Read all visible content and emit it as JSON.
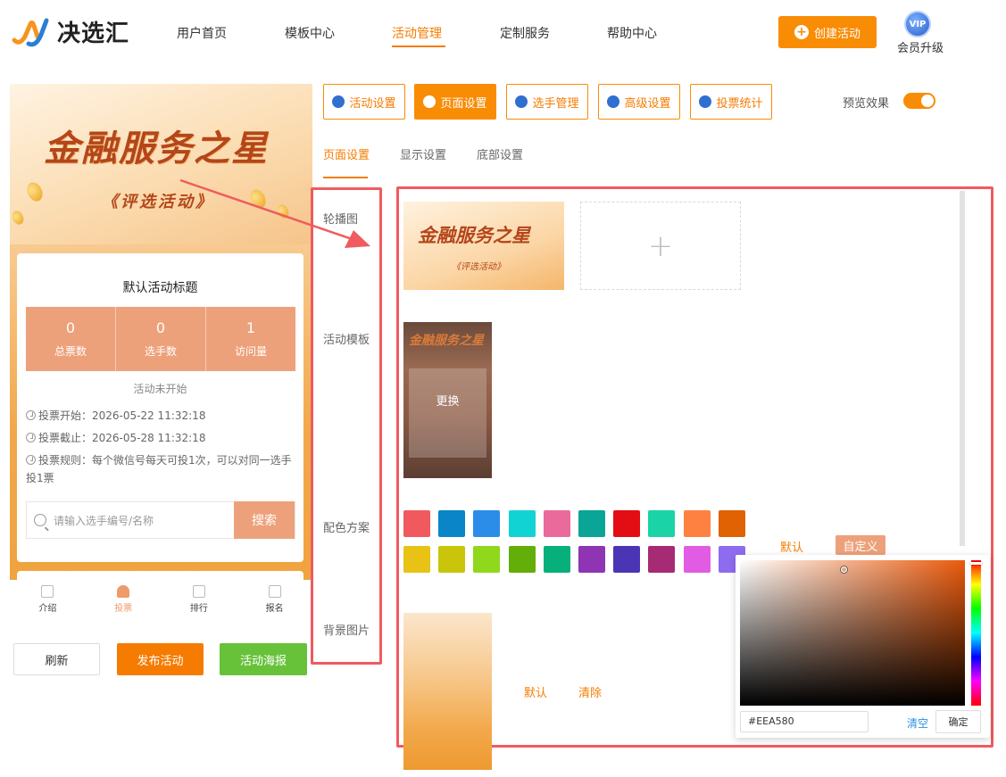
{
  "header": {
    "logo_text": "决选汇",
    "nav": [
      "用户首页",
      "模板中心",
      "活动管理",
      "定制服务",
      "帮助中心"
    ],
    "create_label": "创建活动",
    "vip_badge": "VIP",
    "vip_label": "会员升级"
  },
  "preview": {
    "banner_title": "金融服务之星",
    "banner_sub": "《评选活动》",
    "activity_title": "默认活动标题",
    "stats": [
      {
        "value": "0",
        "label": "总票数"
      },
      {
        "value": "0",
        "label": "选手数"
      },
      {
        "value": "1",
        "label": "访问量"
      }
    ],
    "status": "活动未开始",
    "vote_start": "投票开始：2026-05-22 11:32:18",
    "vote_end": "投票截止：2026-05-28 11:32:18",
    "vote_rule": "投票规则：每个微信号每天可投1次，可以对同一选手投1票",
    "search_placeholder": "请输入选手编号/名称",
    "search_btn": "搜索",
    "tabs": [
      {
        "label": "介绍",
        "active": false
      },
      {
        "label": "投票",
        "active": true
      },
      {
        "label": "排行",
        "active": false
      },
      {
        "label": "报名",
        "active": false
      }
    ]
  },
  "actions": {
    "refresh": "刷新",
    "publish": "发布活动",
    "poster": "活动海报"
  },
  "toolbar": {
    "buttons": [
      {
        "label": "活动设置",
        "icon": "star-icon"
      },
      {
        "label": "页面设置",
        "icon": "gear-icon"
      },
      {
        "label": "选手管理",
        "icon": "users-icon"
      },
      {
        "label": "高级设置",
        "icon": "settings-icon"
      },
      {
        "label": "投票统计",
        "icon": "bar-chart-icon"
      }
    ],
    "active": 1,
    "preview_label": "预览效果"
  },
  "subtabs": [
    "页面设置",
    "显示设置",
    "底部设置"
  ],
  "settings": {
    "carousel_label": "轮播图",
    "carousel_title": "金融服务之星",
    "carousel_sub": "《评选活动》",
    "template_label": "活动模板",
    "template_title": "金融服务之星",
    "replace_label": "更换",
    "color_label": "配色方案",
    "color_default": "默认",
    "color_custom": "自定义",
    "bg_label": "背景图片",
    "bg_default": "默认",
    "bg_clear": "清除",
    "swatches": [
      "#f05a5f",
      "#0a86c8",
      "#2b8de8",
      "#12d3d4",
      "#ea6b9b",
      "#0aa596",
      "#e30e13",
      "#1ad3a7",
      "#fe8141",
      "#e06203",
      "#e8c214",
      "#c8c50a",
      "#8fd81c",
      "#63ae08",
      "#07b07a",
      "#8f34b2",
      "#4b35b5",
      "#a62a74",
      "#e25be3",
      "#8e6cf0"
    ]
  },
  "picker": {
    "hex": "#EEA580",
    "clear": "清空",
    "confirm": "确定"
  },
  "colors": {
    "accent": "#f98c05",
    "annotation": "#ef5b5f",
    "stats_bg": "#eda17a",
    "publish": "#f57c00",
    "poster": "#67c23a"
  }
}
